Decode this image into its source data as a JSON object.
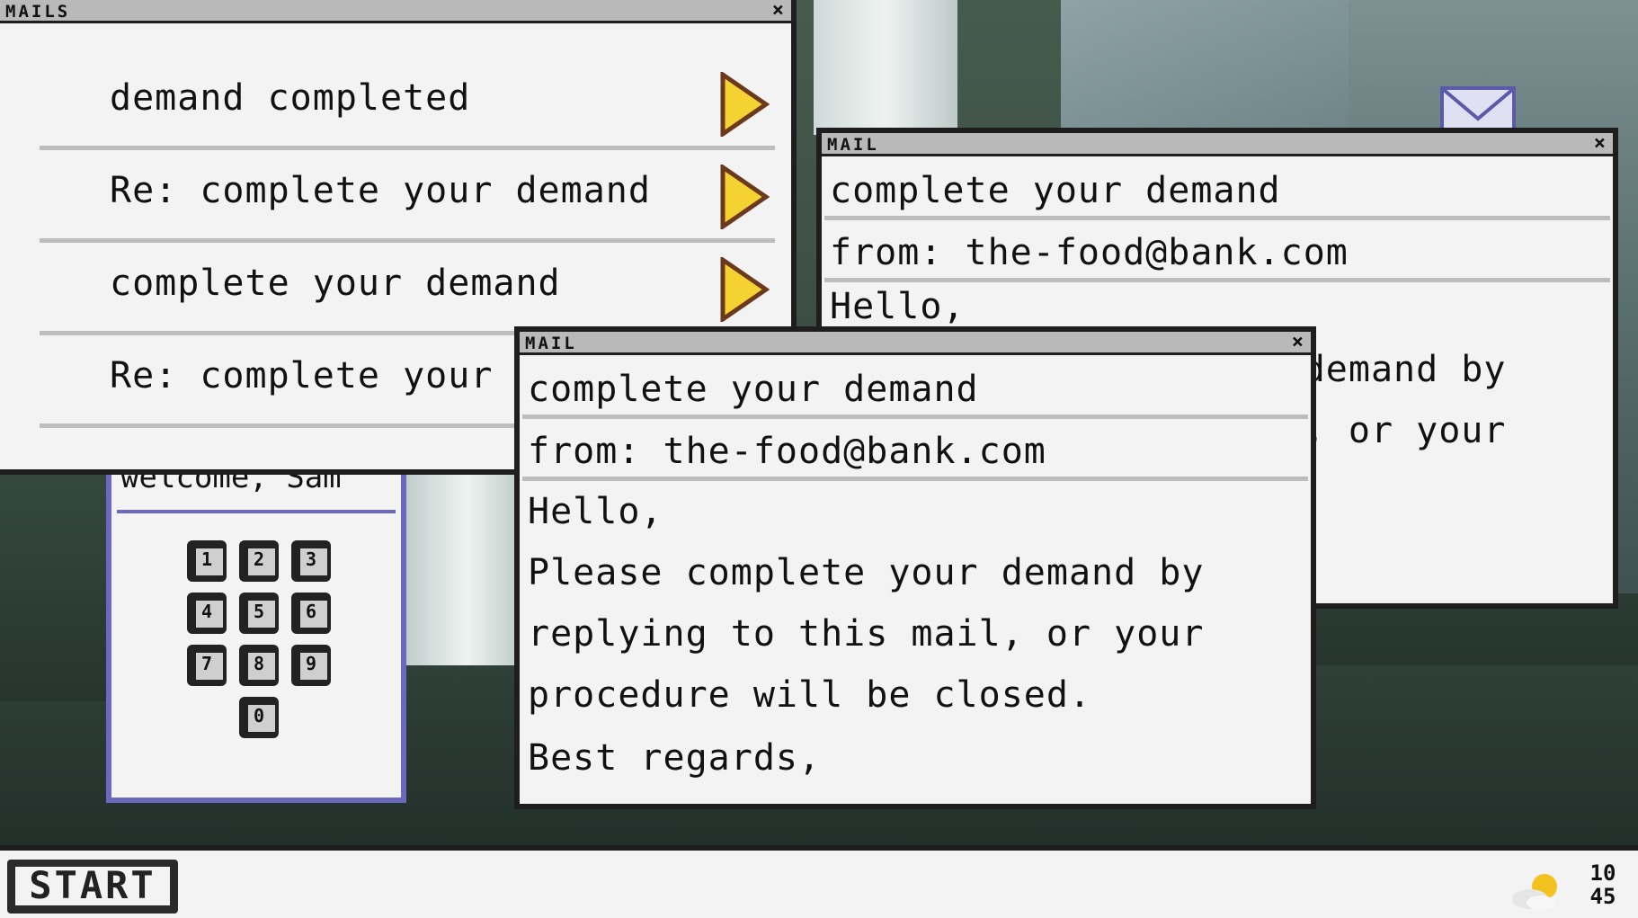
{
  "mails_window": {
    "title": "MAILS",
    "close": "×",
    "items": [
      {
        "subject": "demand completed"
      },
      {
        "subject": "Re: complete your demand"
      },
      {
        "subject": "complete your demand"
      },
      {
        "subject": "Re: complete your demand"
      }
    ]
  },
  "mail_back": {
    "title": "MAIL",
    "close": "×",
    "subject": "complete your demand",
    "from": "from: the-food@bank.com",
    "body": [
      "Hello,",
      "Please complete your demand by",
      "replying to this mail, or your"
    ]
  },
  "mail_front": {
    "title": "MAIL",
    "close": "×",
    "subject": "complete your demand",
    "from": "from: the-food@bank.com",
    "body": [
      "Hello,",
      "Please complete your demand by",
      "replying to this mail, or your",
      "procedure will be closed.",
      "Best regards,"
    ]
  },
  "login": {
    "welcome": "welcome, Sam",
    "keys": [
      "1",
      "2",
      "3",
      "4",
      "5",
      "6",
      "7",
      "8",
      "9",
      "0"
    ]
  },
  "taskbar": {
    "start_label": "START",
    "clock_hour": "10",
    "clock_minute": "45"
  },
  "icons": {
    "arrow": "play-arrow-icon",
    "envelope": "envelope-icon",
    "weather": "partly-sunny-icon"
  },
  "colors": {
    "window_bg": "#f3f3f3",
    "titlebar": "#b9b9b9",
    "border": "#1e1e1e",
    "arrow": "#f4d232",
    "login_border": "#6b68bf"
  }
}
